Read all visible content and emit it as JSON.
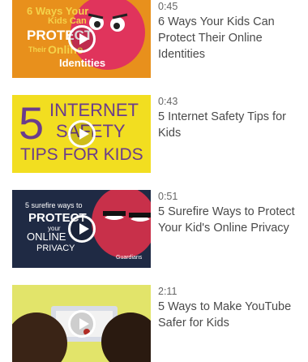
{
  "videos": [
    {
      "duration": "0:45",
      "title": "6 Ways Your Kids Can Protect Their Online Identities",
      "thumb": {
        "line1": "6 Ways Your",
        "line2": "Kids Can",
        "line3": "PROTECT",
        "line4": "Their",
        "line5": "Online",
        "line6": "Identities"
      },
      "colors": {
        "bg": "#e8901c",
        "accent": "#e0345c"
      }
    },
    {
      "duration": "0:43",
      "title": "5 Internet Safety Tips for Kids",
      "thumb": {
        "digit": "5",
        "line1": "INTERNET",
        "line2": "SAFETY",
        "line3": "TIPS FOR KIDS"
      },
      "colors": {
        "bg": "#f2de20",
        "text": "#6a3c8c"
      }
    },
    {
      "duration": "0:51",
      "title": "5 Surefire Ways to Protect Your Kid's Online Privacy",
      "thumb": {
        "line1": "5 surefire ways to",
        "line2": "PROTECT",
        "line3": "your",
        "line4": "ONLINE",
        "line5": "PRIVACY",
        "brand": "Guardians"
      },
      "colors": {
        "bg": "#1f2a44",
        "accent": "#c8304a"
      }
    },
    {
      "duration": "2:11",
      "title": "5 Ways to Make YouTube Safer for Kids",
      "colors": {
        "bg": "#e2e46a",
        "hair": "#3a2416"
      }
    }
  ]
}
